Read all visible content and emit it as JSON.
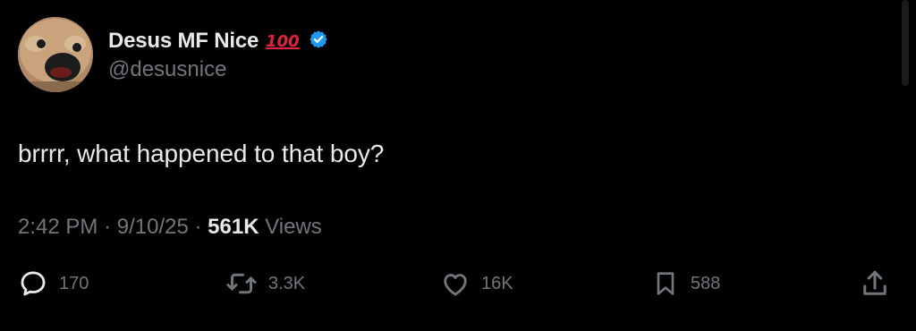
{
  "author": {
    "display_name": "Desus MF Nice",
    "name_emoji": "100",
    "handle": "@desusnice"
  },
  "tweet": {
    "text": "brrrr, what happened to that boy?"
  },
  "meta": {
    "time": "2:42 PM",
    "date": "9/10/25",
    "views_count": "561K",
    "views_label": "Views",
    "separator": "·"
  },
  "actions": {
    "replies": "170",
    "reposts": "3.3K",
    "likes": "16K",
    "bookmarks": "588"
  },
  "icons": {
    "reply": "speech-bubble-icon",
    "repost": "repost-icon",
    "like": "heart-icon",
    "bookmark": "bookmark-icon",
    "share": "share-icon",
    "verified": "verified-badge-icon"
  },
  "colors": {
    "background": "#000000",
    "primary_text": "#e7e9ea",
    "secondary_text": "#71767b",
    "verified_blue": "#1d9bf0",
    "emoji_red": "#e0243a"
  }
}
